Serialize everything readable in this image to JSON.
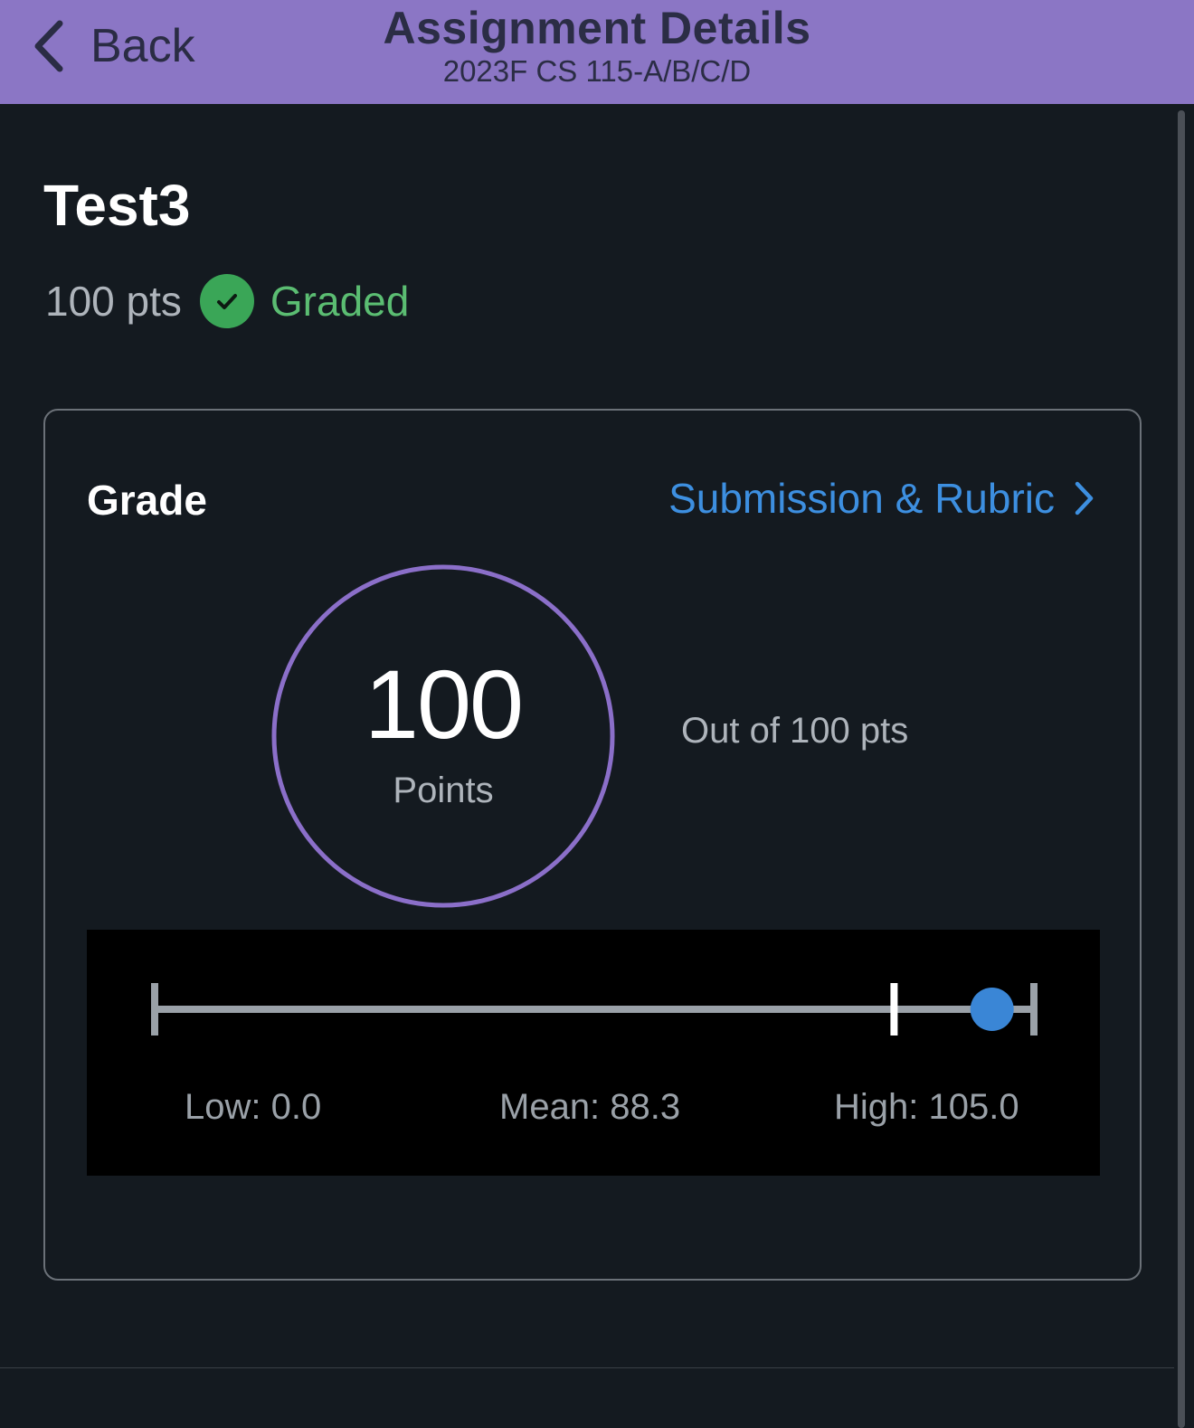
{
  "header": {
    "back_label": "Back",
    "title": "Assignment Details",
    "subtitle": "2023F CS 115-A/B/C/D"
  },
  "assignment": {
    "name": "Test3",
    "points_possible": "100 pts",
    "status": "Graded"
  },
  "grade_card": {
    "label": "Grade",
    "link_label": "Submission & Rubric",
    "score": "100",
    "score_caption": "Points",
    "out_of": "Out of 100 pts",
    "score_fraction_of_ring": 1.0
  },
  "stats": {
    "low_label": "Low: 0.0",
    "mean_label": "Mean: 88.3",
    "high_label": "High: 105.0",
    "low": 0.0,
    "mean": 88.3,
    "high": 105.0,
    "score": 100
  },
  "colors": {
    "header_bg": "#8b76c5",
    "accent_purple": "#8b6fc9",
    "link_blue": "#3d8fe0",
    "graded_green": "#5bbd72",
    "marker_blue": "#3a86d6"
  }
}
